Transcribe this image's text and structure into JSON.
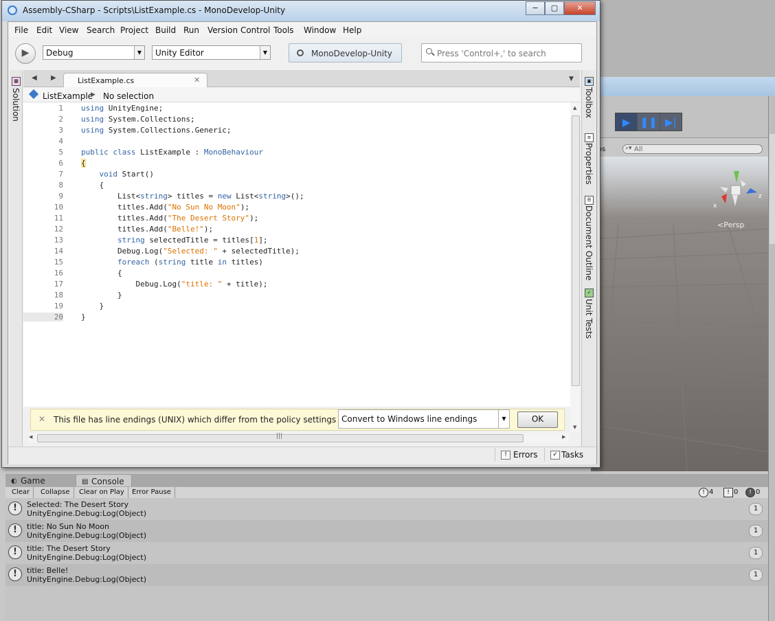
{
  "window": {
    "title": "Assembly-CSharp - Scripts\\ListExample.cs - MonoDevelop-Unity",
    "minimize_glyph": "−",
    "maximize_glyph": "▢",
    "close_glyph": "✕"
  },
  "menu": [
    "File",
    "Edit",
    "View",
    "Search",
    "Project",
    "Build",
    "Run",
    "Version Control",
    "Tools",
    "Window",
    "Help"
  ],
  "toolbar": {
    "run_icon": "play-icon",
    "configuration": "Debug",
    "target": "Unity Editor",
    "status": "MonoDevelop-Unity",
    "search_placeholder": "Press 'Control+,' to search"
  },
  "left_pad": {
    "solution_label": "Solution"
  },
  "right_pad": {
    "toolbox_label": "Toolbox",
    "properties_label": "Properties",
    "outline_label": "Document Outline",
    "unittests_label": "Unit Tests"
  },
  "document": {
    "tab_label": "ListExample.cs",
    "path_class": "ListExample",
    "path_member": "No selection",
    "current_line": 20,
    "lines": [
      {
        "n": 1,
        "text": "using UnityEngine;"
      },
      {
        "n": 2,
        "text": "using System.Collections;"
      },
      {
        "n": 3,
        "text": "using System.Collections.Generic;"
      },
      {
        "n": 4,
        "text": ""
      },
      {
        "n": 5,
        "text": "public class ListExample : MonoBehaviour"
      },
      {
        "n": 6,
        "text": "{"
      },
      {
        "n": 7,
        "text": "    void Start()"
      },
      {
        "n": 8,
        "text": "    {"
      },
      {
        "n": 9,
        "text": "        List<string> titles = new List<string>();"
      },
      {
        "n": 10,
        "text": "        titles.Add(\"No Sun No Moon\");"
      },
      {
        "n": 11,
        "text": "        titles.Add(\"The Desert Story\");"
      },
      {
        "n": 12,
        "text": "        titles.Add(\"Belle!\");"
      },
      {
        "n": 13,
        "text": "        string selectedTitle = titles[1];"
      },
      {
        "n": 14,
        "text": "        Debug.Log(\"Selected: \" + selectedTitle);"
      },
      {
        "n": 15,
        "text": "        foreach (string title in titles)"
      },
      {
        "n": 16,
        "text": "        {"
      },
      {
        "n": 17,
        "text": "            Debug.Log(\"title: \" + title);"
      },
      {
        "n": 18,
        "text": "        }"
      },
      {
        "n": 19,
        "text": "    }"
      },
      {
        "n": 20,
        "text": "}"
      }
    ]
  },
  "infobar": {
    "message": "This file has line endings (UNIX) which differ from the policy settings (Wind...",
    "option": "Convert to Windows line endings",
    "ok_label": "OK"
  },
  "statusbar": {
    "errors_label": "Errors",
    "tasks_label": "Tasks"
  },
  "unity": {
    "scene_search": "All",
    "gizmos_label": "os",
    "persp_label": "<Persp",
    "axis_x": "x",
    "axis_z": "z"
  },
  "console": {
    "tabs": {
      "game": "Game",
      "console": "Console"
    },
    "buttons": [
      "Clear",
      "Collapse",
      "Clear on Play",
      "Error Pause"
    ],
    "counts": {
      "info": "4",
      "warnings": "0",
      "errors": "0"
    },
    "entries": [
      {
        "line1": "Selected: The Desert Story",
        "line2": "UnityEngine.Debug:Log(Object)",
        "count": "1"
      },
      {
        "line1": "title: No Sun No Moon",
        "line2": "UnityEngine.Debug:Log(Object)",
        "count": "1"
      },
      {
        "line1": "title: The Desert Story",
        "line2": "UnityEngine.Debug:Log(Object)",
        "count": "1"
      },
      {
        "line1": "title: Belle!",
        "line2": "UnityEngine.Debug:Log(Object)",
        "count": "1"
      }
    ]
  }
}
